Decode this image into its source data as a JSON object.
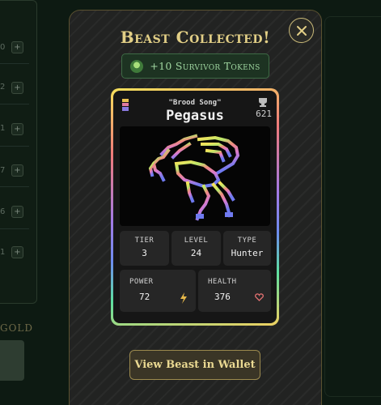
{
  "background": {
    "rows": [
      "0",
      "2",
      "1",
      "7",
      "6",
      "1"
    ],
    "gold_label": "GOLD"
  },
  "modal": {
    "title": "Beast Collected!",
    "reward": "+10 Survivor Tokens",
    "close_icon": "close-icon",
    "wallet_button": "View Beast in Wallet"
  },
  "beast": {
    "subtitle": "\"Brood Song\"",
    "name": "Pegasus",
    "score": "621",
    "stats": {
      "tier_label": "TIER",
      "tier": "3",
      "level_label": "LEVEL",
      "level": "24",
      "type_label": "TYPE",
      "type": "Hunter",
      "power_label": "POWER",
      "power": "72",
      "health_label": "HEALTH",
      "health": "376"
    }
  },
  "colors": {
    "title": "#e2cf86",
    "reward_text": "#9fd6a0",
    "power_icon": "#e6b84a",
    "health_icon": "#e07070"
  }
}
